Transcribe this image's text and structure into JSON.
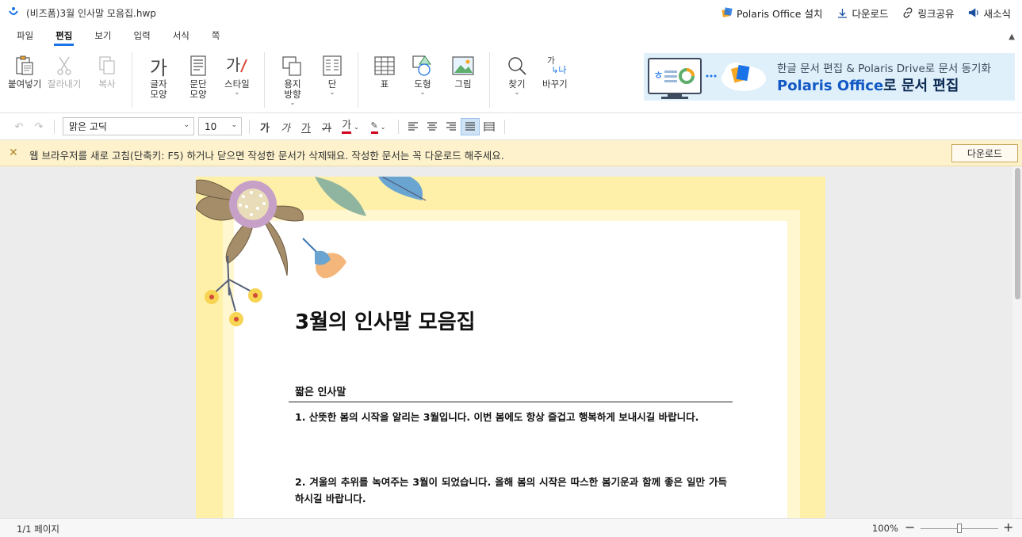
{
  "titlebar": {
    "doc_title": "(비즈폼)3월 인사말 모음집.hwp",
    "actions": {
      "install": "Polaris Office 설치",
      "download": "다운로드",
      "share": "링크공유",
      "news": "새소식"
    }
  },
  "menu": {
    "tabs": [
      "파일",
      "편집",
      "보기",
      "입력",
      "서식",
      "쪽"
    ],
    "active": "편집"
  },
  "ribbon": {
    "paste": "붙여넣기",
    "cut": "잘라내기",
    "copy": "복사",
    "char_shape": [
      "글자",
      "모양"
    ],
    "para_shape": [
      "문단",
      "모양"
    ],
    "style": "스타일",
    "page_dir": [
      "용지",
      "방향"
    ],
    "columns": "단",
    "table": "표",
    "shape": "도형",
    "image": "그림",
    "find": "찾기",
    "replace": "바꾸기",
    "icon_char": "가",
    "replace_icon_top": "가",
    "replace_icon_bottom": "나"
  },
  "promo": {
    "line1": "한글 문서 편집 & Polaris Drive로 문서 동기화",
    "line2_a": "Polaris Office",
    "line2_b": "로 문서 편집"
  },
  "format": {
    "font_name": "맑은 고딕",
    "font_size": "10",
    "glyph": "가"
  },
  "notice": {
    "text": "웹 브라우저를 새로 고침(단축키: F5) 하거나 닫으면 작성한 문서가 삭제돼요. 작성한 문서는 꼭 다운로드 해주세요.",
    "button": "다운로드"
  },
  "document": {
    "heading": "3월의 인사말 모음집",
    "subheading": "짧은 인사말",
    "paragraphs": [
      "1. 산뜻한 봄의 시작을 알리는 3월입니다. 이번 봄에도 항상 즐겁고 행복하게 보내시길 바랍니다.",
      "2. 겨울의 추위를 녹여주는 3월이 되었습니다. 올해 봄의 시작은 따스한 봄기운과 함께 좋은 일만 가득하시길 바랍니다."
    ]
  },
  "status": {
    "page": "1/1 페이지",
    "zoom": "100%"
  },
  "colors": {
    "accent": "#1a73e8",
    "notice_bg": "#fdf2cc",
    "page_border": "#fef0a8"
  }
}
